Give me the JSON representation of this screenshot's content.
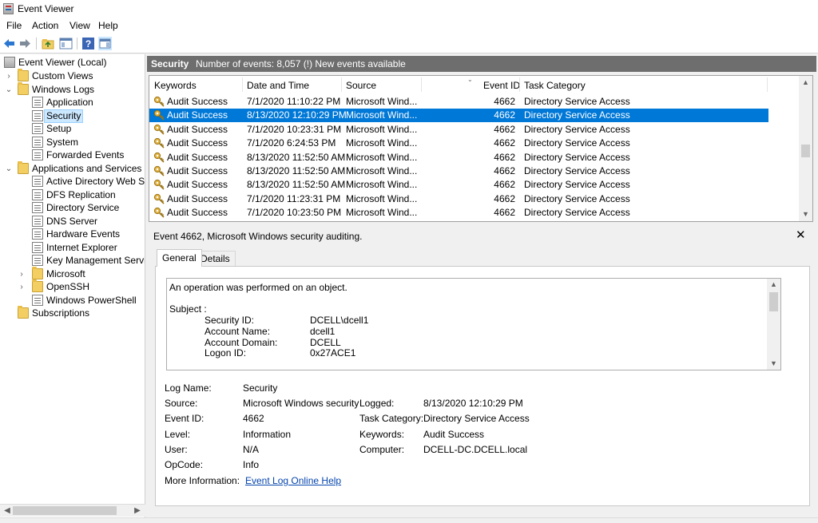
{
  "window": {
    "title": "Event Viewer"
  },
  "menu": [
    "File",
    "Action",
    "View",
    "Help"
  ],
  "toolbar": {
    "icons": [
      "back-arrow-icon",
      "forward-arrow-icon",
      "up-folder-icon",
      "show-hide-tree-icon",
      "help-icon",
      "show-hide-action-pane-icon"
    ]
  },
  "tree": {
    "items": [
      {
        "label": "Event Viewer (Local)",
        "icon": "event-viewer-icon"
      },
      {
        "label": "Custom Views",
        "icon": "folder-icon"
      },
      {
        "label": "Windows Logs",
        "icon": "folder-icon"
      },
      {
        "label": "Application",
        "icon": "log-icon"
      },
      {
        "label": "Security",
        "icon": "log-icon",
        "selected": true
      },
      {
        "label": "Setup",
        "icon": "log-icon"
      },
      {
        "label": "System",
        "icon": "log-icon"
      },
      {
        "label": "Forwarded Events",
        "icon": "log-icon"
      },
      {
        "label": "Applications and Services Lo",
        "icon": "folder-icon"
      },
      {
        "label": "Active Directory Web Ser",
        "icon": "log-icon"
      },
      {
        "label": "DFS Replication",
        "icon": "log-icon"
      },
      {
        "label": "Directory Service",
        "icon": "log-icon"
      },
      {
        "label": "DNS Server",
        "icon": "log-icon"
      },
      {
        "label": "Hardware Events",
        "icon": "log-icon"
      },
      {
        "label": "Internet Explorer",
        "icon": "log-icon"
      },
      {
        "label": "Key Management Service",
        "icon": "log-icon"
      },
      {
        "label": "Microsoft",
        "icon": "folder-icon"
      },
      {
        "label": "OpenSSH",
        "icon": "folder-icon"
      },
      {
        "label": "Windows PowerShell",
        "icon": "log-icon"
      },
      {
        "label": "Subscriptions",
        "icon": "subscriptions-icon"
      }
    ]
  },
  "log_header": {
    "name": "Security",
    "info": "Number of events: 8,057 (!) New events available"
  },
  "events": {
    "columns": [
      "Keywords",
      "Date and Time",
      "Source",
      "Event ID",
      "Task Category"
    ],
    "rows": [
      [
        "Audit Success",
        "7/1/2020 11:10:22 PM",
        "Microsoft Wind...",
        "4662",
        "Directory Service Access"
      ],
      [
        "Audit Success",
        "8/13/2020 12:10:29 PM",
        "Microsoft Wind...",
        "4662",
        "Directory Service Access"
      ],
      [
        "Audit Success",
        "7/1/2020 10:23:31 PM",
        "Microsoft Wind...",
        "4662",
        "Directory Service Access"
      ],
      [
        "Audit Success",
        "7/1/2020 6:24:53 PM",
        "Microsoft Wind...",
        "4662",
        "Directory Service Access"
      ],
      [
        "Audit Success",
        "8/13/2020 11:52:50 AM",
        "Microsoft Wind...",
        "4662",
        "Directory Service Access"
      ],
      [
        "Audit Success",
        "8/13/2020 11:52:50 AM",
        "Microsoft Wind...",
        "4662",
        "Directory Service Access"
      ],
      [
        "Audit Success",
        "8/13/2020 11:52:50 AM",
        "Microsoft Wind...",
        "4662",
        "Directory Service Access"
      ],
      [
        "Audit Success",
        "7/1/2020 11:23:31 PM",
        "Microsoft Wind...",
        "4662",
        "Directory Service Access"
      ],
      [
        "Audit Success",
        "7/1/2020 10:23:50 PM",
        "Microsoft Wind...",
        "4662",
        "Directory Service Access"
      ]
    ],
    "selected_row": 1
  },
  "detail": {
    "title": "Event 4662, Microsoft Windows security auditing.",
    "close": "✕",
    "tabs": [
      "General",
      "Details"
    ],
    "active_tab": "General",
    "description": {
      "line1": "An operation was performed on an object.",
      "subject_label": "Subject :",
      "fields": [
        {
          "label": "Security ID:",
          "value": "DCELL\\dcell1"
        },
        {
          "label": "Account Name:",
          "value": "dcell1"
        },
        {
          "label": "Account Domain:",
          "value": "DCELL"
        },
        {
          "label": "Logon ID:",
          "value": "0x27ACE1"
        }
      ]
    },
    "properties": {
      "log_name_label": "Log Name:",
      "log_name": "Security",
      "source_label": "Source:",
      "source": "Microsoft Windows security",
      "logged_label": "Logged:",
      "logged": "8/13/2020 12:10:29 PM",
      "event_id_label": "Event ID:",
      "event_id": "4662",
      "task_category_label": "Task Category:",
      "task_category": "Directory Service Access",
      "level_label": "Level:",
      "level": "Information",
      "keywords_label": "Keywords:",
      "keywords": "Audit Success",
      "user_label": "User:",
      "user": "N/A",
      "computer_label": "Computer:",
      "computer": "DCELL-DC.DCELL.local",
      "opcode_label": "OpCode:",
      "opcode": "Info",
      "more_info_label": "More Information:",
      "more_info_link": "Event Log Online Help"
    }
  },
  "colors": {
    "selection": "#0078d7",
    "header_bar": "#6e6e6e",
    "tree_selection": "#cce8ff",
    "link": "#0645ad"
  }
}
